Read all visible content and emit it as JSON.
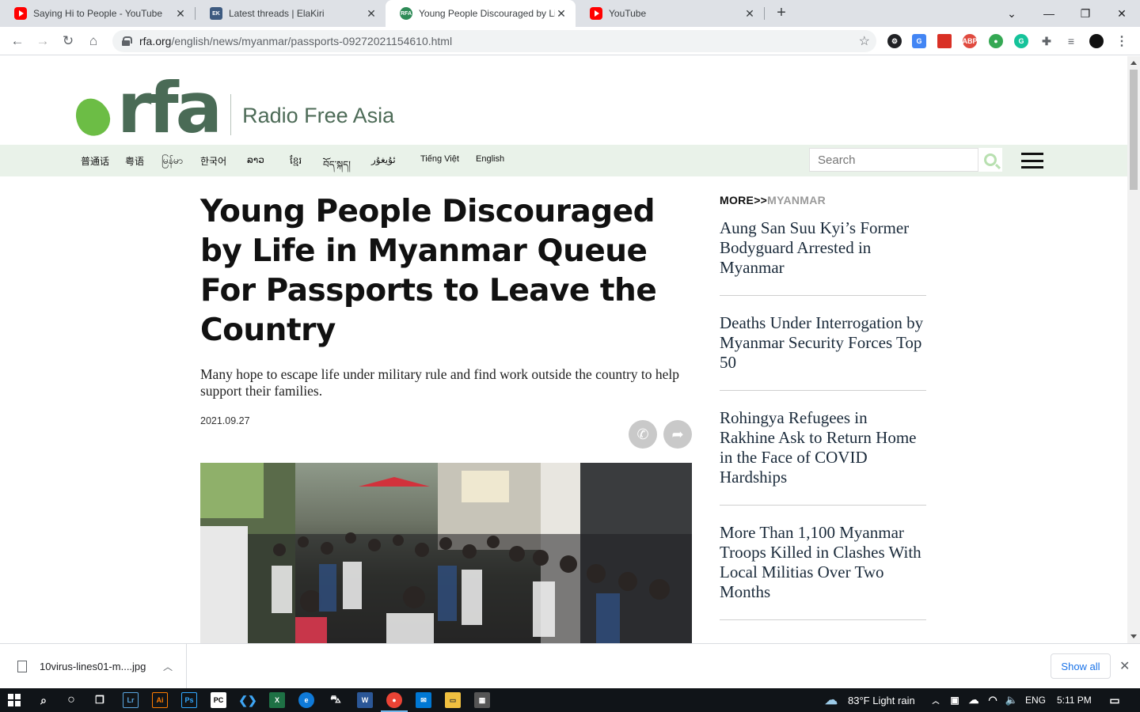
{
  "browser": {
    "tabs": [
      {
        "title": "Saying Hi to People - YouTube",
        "icon": "youtube-icon"
      },
      {
        "title": "Latest threads | ElaKiri",
        "icon": "elakiri-icon"
      },
      {
        "title": "Young People Discouraged by Lif",
        "icon": "rfa-icon"
      },
      {
        "title": "YouTube",
        "icon": "youtube-icon"
      }
    ],
    "url_host": "rfa.org",
    "url_path": "/english/news/myanmar/passports-09272021154610.html"
  },
  "site": {
    "logo_text": "rfa",
    "name": "Radio Free Asia",
    "languages": [
      "普通话",
      "粤语",
      "မြန်မာ",
      "한국어",
      "ລາວ",
      "ខ្មែរ",
      "བོད་སྐད།",
      "ئۇيغۇر",
      "Tiếng Việt",
      "English"
    ],
    "search_placeholder": "Search"
  },
  "article": {
    "headline": "Young People Discouraged by Life in Myanmar Queue For Passports to Leave the Country",
    "subhead": "Many hope to escape life under military rule and find work outside the country to help support their families.",
    "date": "2021.09.27"
  },
  "sidebar": {
    "more_label": "MORE>>",
    "section": "MYANMAR",
    "stories": [
      "Aung San Suu Kyi’s Former Bodyguard Arrested in Myanmar",
      "Deaths Under Interrogation by Myanmar Security Forces Top 50",
      "Rohingya Refugees in Rakhine Ask to Return Home in the Face of COVID Hardships",
      "More Than 1,100 Myanmar Troops Killed in Clashes With Local Militias Over Two Months"
    ]
  },
  "downloads": {
    "file": "10virus-lines01-m....jpg",
    "show_all": "Show all"
  },
  "taskbar": {
    "weather": "83°F  Light rain",
    "lang": "ENG",
    "time": "5:11 PM"
  }
}
